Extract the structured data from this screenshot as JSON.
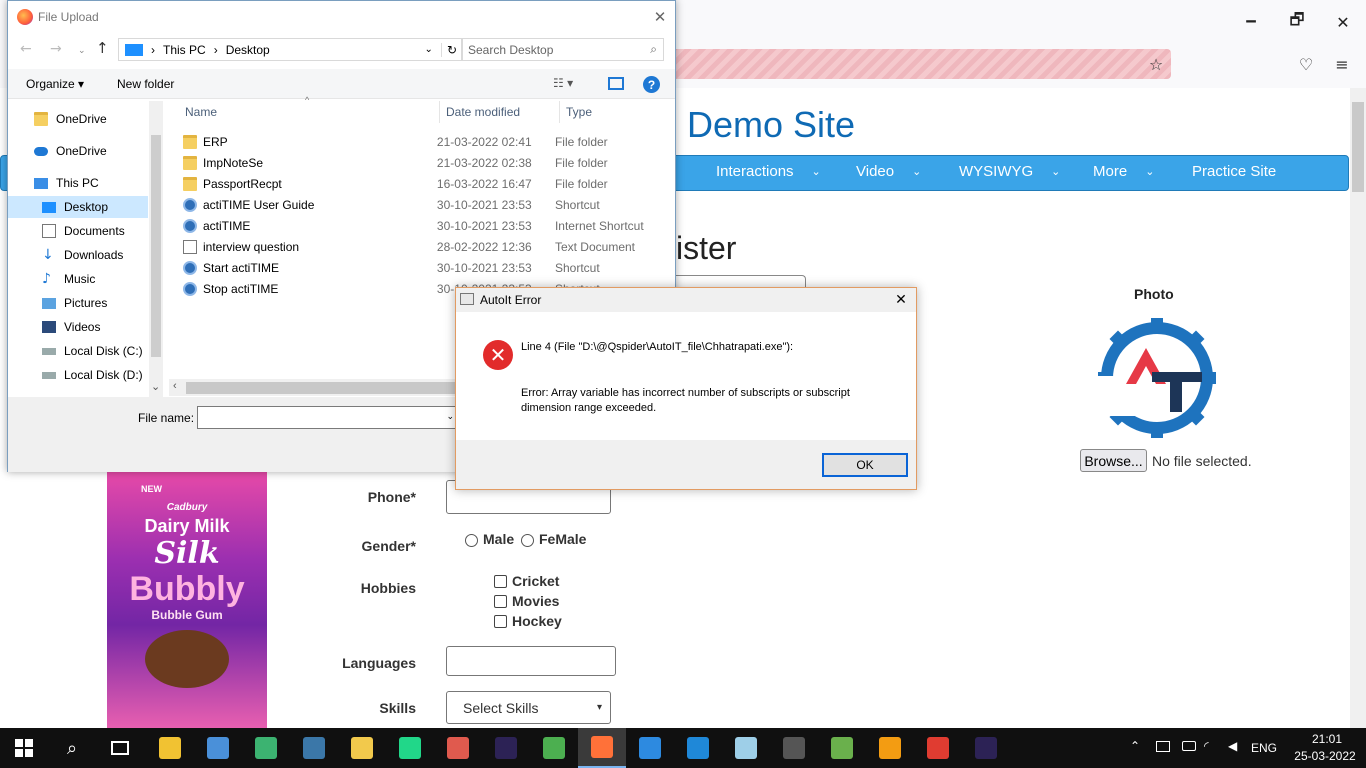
{
  "browser": {
    "window_controls": {
      "minimize": "🗕",
      "maximize": "🗗",
      "close": "✕"
    },
    "toolbar_icons": [
      "bookmark-star-icon",
      "pocket-icon",
      "menu-icon"
    ]
  },
  "site": {
    "title": "Demo Site",
    "nav": [
      {
        "label": "Interactions",
        "chevron": "⌄"
      },
      {
        "label": "Video",
        "chevron": "⌄"
      },
      {
        "label": "WYSIWYG",
        "chevron": "⌄"
      },
      {
        "label": "More",
        "chevron": "⌄"
      },
      {
        "label": "Practice Site",
        "chevron": ""
      }
    ],
    "heading_partial": "ister",
    "photo_label": "Photo",
    "browse_label": "Browse...",
    "no_file_text": "No file selected.",
    "form": {
      "phone_label": "Phone*",
      "gender_label": "Gender*",
      "gender_options": [
        "Male",
        "FeMale"
      ],
      "hobbies_label": "Hobbies",
      "hobbies_options": [
        "Cricket",
        "Movies",
        "Hockey"
      ],
      "languages_label": "Languages",
      "skills_label": "Skills",
      "skills_placeholder": "Select Skills"
    },
    "ad": {
      "brand": "Cadbury",
      "line1": "Dairy Milk",
      "line2": "Silk",
      "line3": "Bubbly",
      "line4": "Bubble Gum",
      "badge": "NEW"
    }
  },
  "file_dialog": {
    "title": "File Upload",
    "close": "✕",
    "breadcrumb": [
      "This PC",
      "Desktop"
    ],
    "search_placeholder": "Search Desktop",
    "organize": "Organize ▾",
    "new_folder": "New folder",
    "sidebar": [
      {
        "label": "OneDrive",
        "icon": "folder-icon"
      },
      {
        "label": "OneDrive",
        "icon": "cloud-icon"
      },
      {
        "label": "This PC",
        "icon": "computer-icon"
      },
      {
        "label": "Desktop",
        "icon": "desktop-icon",
        "selected": true
      },
      {
        "label": "Documents",
        "icon": "documents-icon"
      },
      {
        "label": "Downloads",
        "icon": "downloads-icon"
      },
      {
        "label": "Music",
        "icon": "music-icon"
      },
      {
        "label": "Pictures",
        "icon": "pictures-icon"
      },
      {
        "label": "Videos",
        "icon": "videos-icon"
      },
      {
        "label": "Local Disk (C:)",
        "icon": "drive-icon"
      },
      {
        "label": "Local Disk (D:)",
        "icon": "drive-icon"
      }
    ],
    "columns": [
      "Name",
      "Date modified",
      "Type"
    ],
    "files": [
      {
        "name": "ERP",
        "date": "21-03-2022 02:41",
        "type": "File folder",
        "icon": "folder"
      },
      {
        "name": "ImpNoteSe",
        "date": "21-03-2022 02:38",
        "type": "File folder",
        "icon": "folder"
      },
      {
        "name": "PassportRecpt",
        "date": "16-03-2022 16:47",
        "type": "File folder",
        "icon": "folder"
      },
      {
        "name": "actiTIME User Guide",
        "date": "30-10-2021 23:53",
        "type": "Shortcut",
        "icon": "shortcut"
      },
      {
        "name": "actiTIME",
        "date": "30-10-2021 23:53",
        "type": "Internet Shortcut",
        "icon": "shortcut"
      },
      {
        "name": "interview question",
        "date": "28-02-2022 12:36",
        "type": "Text Document",
        "icon": "doc"
      },
      {
        "name": "Start actiTIME",
        "date": "30-10-2021 23:53",
        "type": "Shortcut",
        "icon": "shortcut"
      },
      {
        "name": "Stop actiTIME",
        "date": "30-10-2021 23:53",
        "type": "Shortcut",
        "icon": "shortcut"
      }
    ],
    "file_name_label": "File name:",
    "file_name_value": ""
  },
  "autoit": {
    "title": "AutoIt Error",
    "line": "Line 4  (File \"D:\\@Qspider\\AutoIT_file\\Chhatrapati.exe\"):",
    "error": "Error: Array variable has incorrect number of subscripts or subscript dimension range exceeded.",
    "ok": "OK",
    "close": "✕"
  },
  "taskbar": {
    "apps": [
      {
        "name": "file-explorer",
        "color": "#f1c232"
      },
      {
        "name": "control-panel",
        "color": "#4a90d9"
      },
      {
        "name": "app-green-plus",
        "color": "#3cb371"
      },
      {
        "name": "python",
        "color": "#3b77a8"
      },
      {
        "name": "python-idle",
        "color": "#f2c94c"
      },
      {
        "name": "pycharm",
        "color": "#21d789"
      },
      {
        "name": "app-red",
        "color": "#e05a4e"
      },
      {
        "name": "eclipse",
        "color": "#2c2255"
      },
      {
        "name": "chrome",
        "color": "#4caf50"
      },
      {
        "name": "firefox",
        "color": "#ff7139",
        "active": true
      },
      {
        "name": "internet-explorer",
        "color": "#2d8ae0"
      },
      {
        "name": "edge",
        "color": "#1f88d8"
      },
      {
        "name": "app-notepad",
        "color": "#9ecfe8"
      },
      {
        "name": "calculator",
        "color": "#555555"
      },
      {
        "name": "app-p",
        "color": "#6ab04c"
      },
      {
        "name": "app-s",
        "color": "#f39c12"
      },
      {
        "name": "app-t",
        "color": "#e03c31"
      },
      {
        "name": "eclipse-2",
        "color": "#2c2255"
      }
    ],
    "language": "ENG",
    "time": "21:01",
    "date": "25-03-2022"
  }
}
